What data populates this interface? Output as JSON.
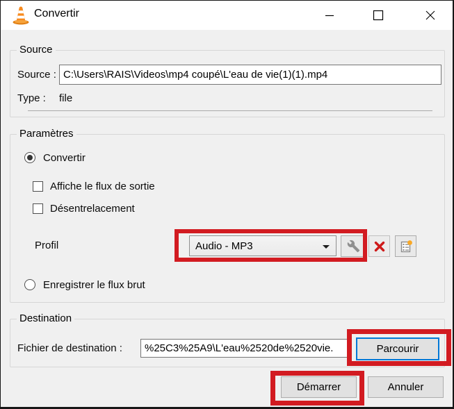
{
  "window": {
    "title": "Convertir"
  },
  "source": {
    "group_title": "Source",
    "source_label": "Source :",
    "source_value": "C:\\Users\\RAIS\\Videos\\mp4 coupé\\L'eau de vie(1)(1).mp4",
    "type_label": "Type :",
    "type_value": "file"
  },
  "parameters": {
    "group_title": "Paramètres",
    "convert_radio_label": "Convertir",
    "convert_selected": true,
    "display_output_checkbox_label": "Affiche le flux de sortie",
    "display_output_checked": false,
    "deinterlace_checkbox_label": "Désentrelacement",
    "deinterlace_checked": false,
    "profile_label": "Profil",
    "profile_value": "Audio - MP3",
    "dump_radio_label": "Enregistrer le flux brut",
    "dump_selected": false
  },
  "destination": {
    "group_title": "Destination",
    "file_label": "Fichier de destination :",
    "file_value": "%25C3%25A9\\L'eau%2520de%2520vie.",
    "browse_button": "Parcourir"
  },
  "actions": {
    "start_button": "Démarrer",
    "cancel_button": "Annuler"
  },
  "icons": {
    "app_icon": "vlc-cone",
    "minimize": "thin-dash",
    "maximize": "outline-square",
    "close": "thin-x",
    "combo_arrow": "down-triangle",
    "profile_edit": "wrench",
    "profile_delete": "red-x",
    "profile_new": "list-with-orange-badge"
  },
  "colors": {
    "highlight_red": "#d21b21",
    "focus_blue": "#0078d7",
    "vlc_orange": "#f78a1e",
    "dialog_bg": "#f0f0f0",
    "titlebar_bg": "#ffffff"
  }
}
